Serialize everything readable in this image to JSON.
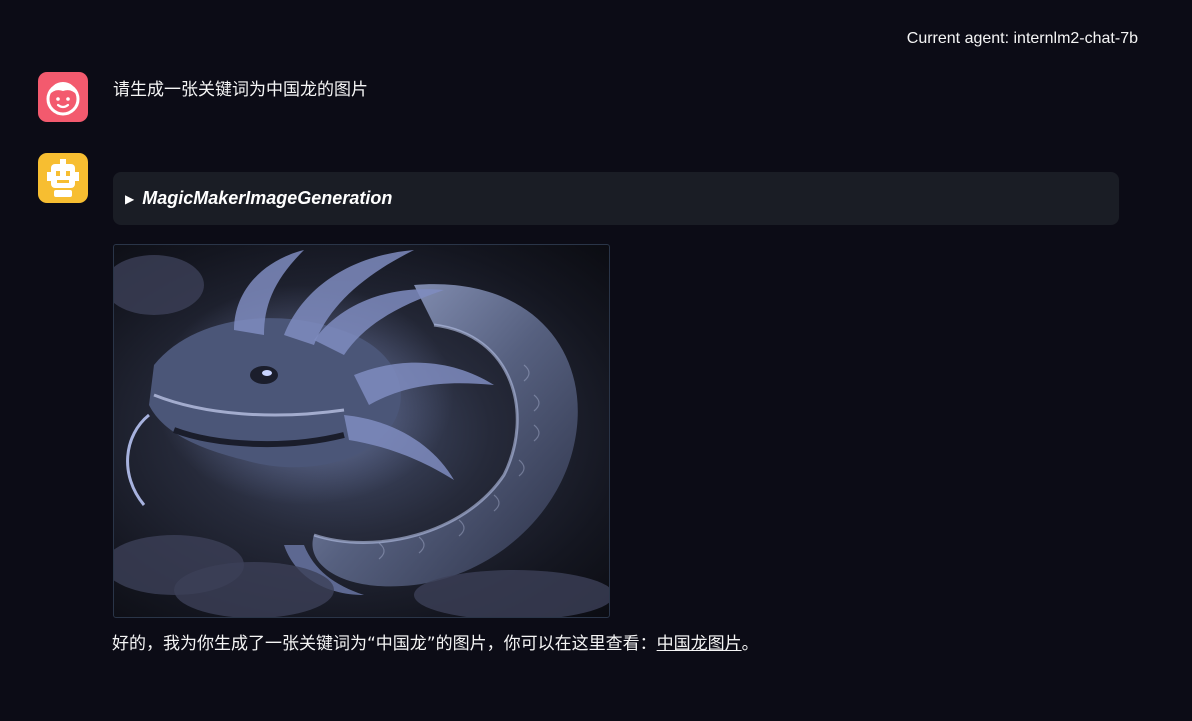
{
  "header": {
    "agent_label": "Current agent: internlm2-chat-7b"
  },
  "conversation": {
    "user_message": "请生成一张关键词为中国龙的图片",
    "bot": {
      "tool_call": {
        "expand_marker": "▶",
        "name": "MagicMakerImageGeneration"
      },
      "image": {
        "subject": "Chinese dragon with blue-silver scales"
      },
      "reply_prefix": "好的，我为你生成了一张关键词为“中国龙”的图片，你可以在这里查看：",
      "reply_link": "中国龙图片",
      "reply_suffix": "。"
    }
  },
  "colors": {
    "background": "#0c0c16",
    "user_avatar": "#f35a6e",
    "bot_avatar": "#f7be31",
    "tool_panel": "#1a1d25"
  },
  "icons": {
    "user_avatar": "smiling-face-icon",
    "bot_avatar": "robot-face-icon"
  }
}
